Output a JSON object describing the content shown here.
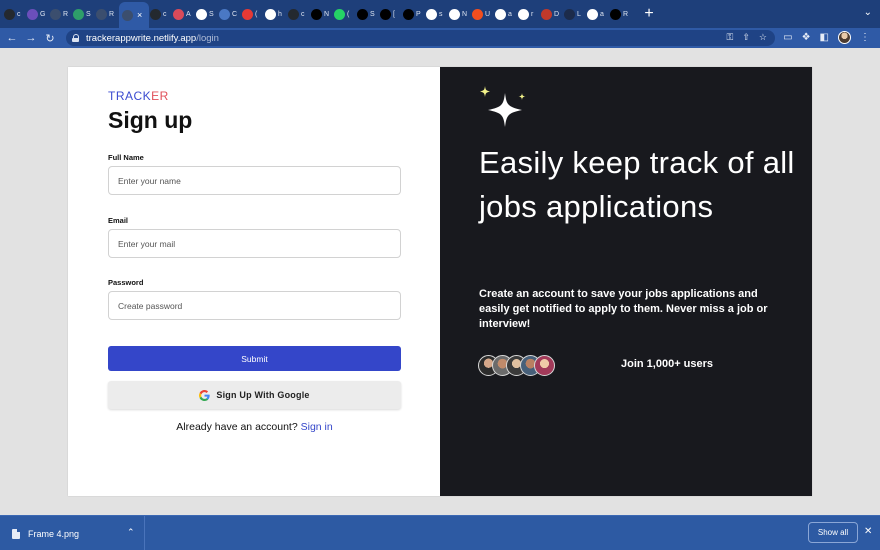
{
  "browser": {
    "tabs": [
      {
        "icon": "github-icon",
        "text": "c",
        "color": "#24292f"
      },
      {
        "icon": "chart-icon",
        "text": "G",
        "color": "#6b4fbb"
      },
      {
        "icon": "react-icon",
        "text": "R",
        "color": "#3b4e6e"
      },
      {
        "icon": "diamond-icon",
        "text": "S",
        "color": "#2e9e6a"
      },
      {
        "icon": "react-icon",
        "text": "R",
        "color": "#3b4e6e"
      },
      {
        "icon": "react-icon",
        "text": "×",
        "color": "#3b4e6e",
        "active": true
      },
      {
        "icon": "github-icon",
        "text": "c",
        "color": "#24292f"
      },
      {
        "icon": "toggle-icon",
        "text": "A",
        "color": "#d94a5a"
      },
      {
        "icon": "google-icon",
        "text": "S",
        "color": "#ffffff"
      },
      {
        "icon": "api-icon",
        "text": "C",
        "color": "#4a78c4"
      },
      {
        "icon": "youtube-icon",
        "text": "(",
        "color": "#e53935"
      },
      {
        "icon": "google-icon",
        "text": "h",
        "color": "#ffffff"
      },
      {
        "icon": "github-icon",
        "text": "c",
        "color": "#24292f"
      },
      {
        "icon": "dev-icon",
        "text": "N",
        "color": "#000000"
      },
      {
        "icon": "whatsapp-icon",
        "text": "(",
        "color": "#25d366"
      },
      {
        "icon": "dev-icon",
        "text": "S",
        "color": "#000000"
      },
      {
        "icon": "dev-icon",
        "text": "[",
        "color": "#000000"
      },
      {
        "icon": "dev-icon",
        "text": "P",
        "color": "#000000"
      },
      {
        "icon": "google-icon",
        "text": "s",
        "color": "#ffffff"
      },
      {
        "icon": "github-icon",
        "text": "N",
        "color": "#ffffff"
      },
      {
        "icon": "figma-icon",
        "text": "U",
        "color": "#f24e1e"
      },
      {
        "icon": "google-icon",
        "text": "a",
        "color": "#ffffff"
      },
      {
        "icon": "google-icon",
        "text": "r",
        "color": "#ffffff"
      },
      {
        "icon": "circle-icon",
        "text": "D",
        "color": "#c0392b"
      },
      {
        "icon": "dark-square-icon",
        "text": "L",
        "color": "#1c2b4a"
      },
      {
        "icon": "google-icon",
        "text": "a",
        "color": "#ffffff"
      },
      {
        "icon": "dev-icon",
        "text": "R",
        "color": "#000000"
      }
    ],
    "address": {
      "host": "trackerappwrite.netlify.app",
      "path": "/login"
    }
  },
  "left": {
    "brand_a": "TRACK",
    "brand_b": "ER",
    "title": "Sign up",
    "fullname_label": "Full Name",
    "fullname_placeholder": "Enter your name",
    "email_label": "Email",
    "email_placeholder": "Enter your mail",
    "password_label": "Password",
    "password_placeholder": "Create password",
    "submit_label": "Submit",
    "google_label": "Sign Up With Google",
    "have_account": "Already have an account?",
    "signin_link": "Sign in"
  },
  "right": {
    "headline": "Easily keep track of all jobs applications",
    "subtext": "Create an account to save your jobs applications and easily get notified to apply to them. Never miss a job or interview!",
    "join": "Join 1,000+ users",
    "sparkle_color": "#f2f28a"
  },
  "shelf": {
    "filename": "Frame 4.png",
    "show_all": "Show all"
  },
  "colors": {
    "brand_blue": "#3446c9",
    "brand_red": "#e0505a",
    "panel_dark": "#18191e",
    "chrome_blue": "#2f5aa6"
  }
}
